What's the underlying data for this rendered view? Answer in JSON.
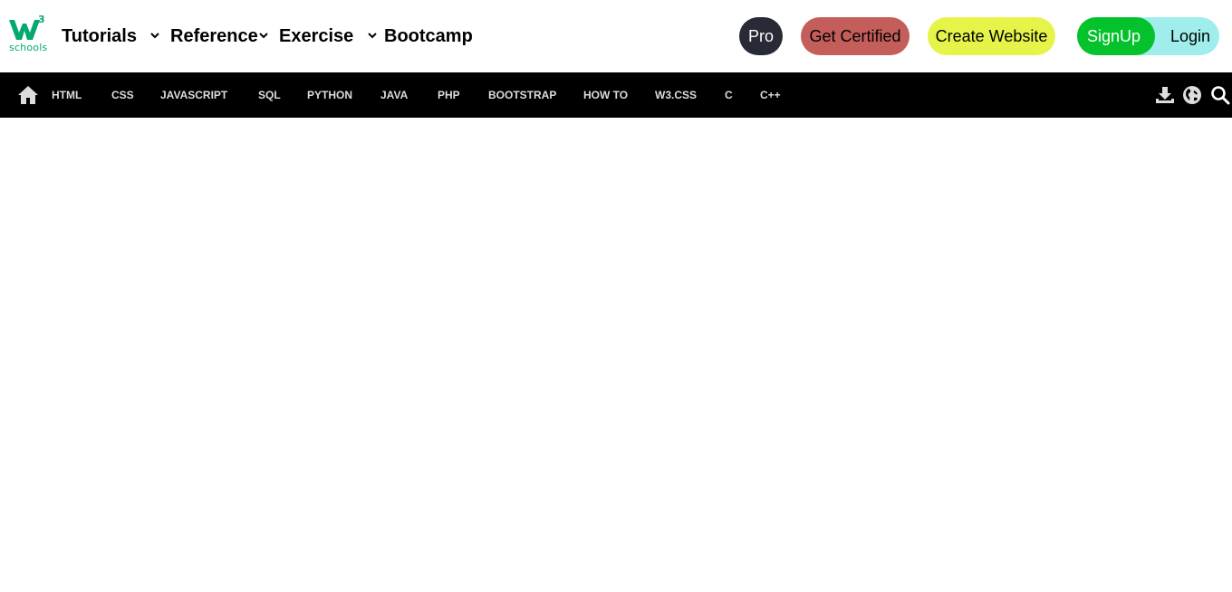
{
  "logo": {
    "brand_mark": "W3",
    "superscript": "3",
    "text": "schools"
  },
  "top_menu": {
    "tutorials": "Tutorials",
    "reference": "Reference",
    "exercise": "Exercise",
    "bootcamp": "Bootcamp"
  },
  "buttons": {
    "pro": "Pro",
    "get_certified": "Get Certified",
    "create_website": "Create Website",
    "signup": "SignUp",
    "login": "Login"
  },
  "nav_links": [
    "HTML",
    "CSS",
    "JAVASCRIPT",
    "SQL",
    "PYTHON",
    "JAVA",
    "PHP",
    "BOOTSTRAP",
    "HOW TO",
    "W3.CSS",
    "C",
    "C++"
  ],
  "icons": {
    "home": "home-icon",
    "download": "download-icon",
    "globe": "globe-icon",
    "search": "search-icon",
    "chevron": "chevron-down-icon"
  },
  "colors": {
    "brand_green": "#04AA6D",
    "pro_bg": "#282A35",
    "certified_bg": "#C45E5B",
    "website_bg": "#E6F44A",
    "signup_bg": "#04C22B",
    "login_bg": "#9FEEEC",
    "nav_bg": "#000000",
    "nav_text": "#DDDDDD"
  }
}
